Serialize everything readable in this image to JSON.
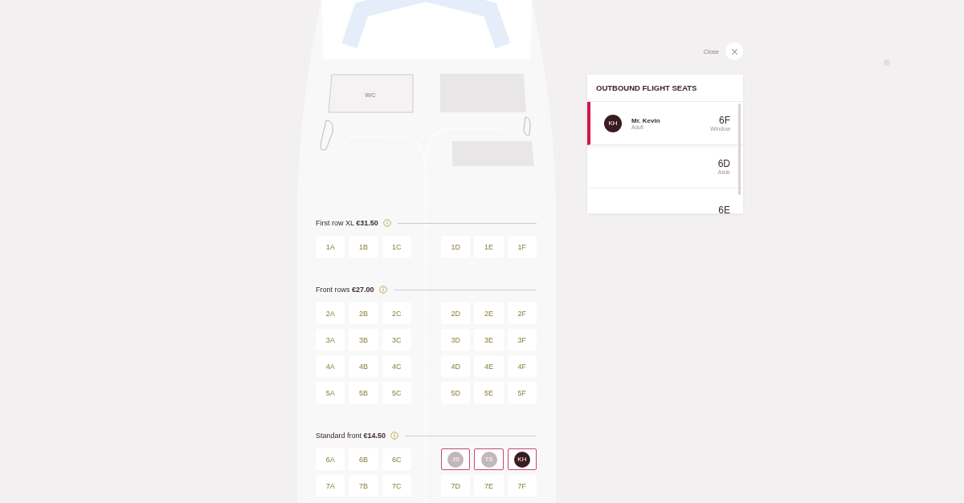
{
  "cabin": {
    "wc_label": "WC"
  },
  "sections": [
    {
      "label": "First row XL **€31.50**",
      "rows": [
        [
          {
            "kind": "free",
            "label": "1A"
          },
          {
            "kind": "free",
            "label": "1B"
          },
          {
            "kind": "free",
            "label": "1C"
          },
          {
            "kind": "free",
            "label": "1D"
          },
          {
            "kind": "free",
            "label": "1E"
          },
          {
            "kind": "free",
            "label": "1F"
          }
        ]
      ]
    },
    {
      "label": "Front rows **€27.00**",
      "rows": [
        [
          {
            "kind": "free",
            "label": "2A"
          },
          {
            "kind": "free",
            "label": "2B"
          },
          {
            "kind": "free",
            "label": "2C"
          },
          {
            "kind": "free",
            "label": "2D"
          },
          {
            "kind": "free",
            "label": "2E"
          },
          {
            "kind": "free",
            "label": "2F"
          }
        ],
        [
          {
            "kind": "free",
            "label": "3A"
          },
          {
            "kind": "free",
            "label": "3B"
          },
          {
            "kind": "free",
            "label": "3C"
          },
          {
            "kind": "free",
            "label": "3D"
          },
          {
            "kind": "free",
            "label": "3E"
          },
          {
            "kind": "free",
            "label": "3F"
          }
        ],
        [
          {
            "kind": "free",
            "label": "4A"
          },
          {
            "kind": "free",
            "label": "4B"
          },
          {
            "kind": "free",
            "label": "4C"
          },
          {
            "kind": "free",
            "label": "4D"
          },
          {
            "kind": "free",
            "label": "4E"
          },
          {
            "kind": "free",
            "label": "4F"
          }
        ],
        [
          {
            "kind": "free",
            "label": "5A"
          },
          {
            "kind": "free",
            "label": "5B"
          },
          {
            "kind": "free",
            "label": "5C"
          },
          {
            "kind": "free",
            "label": "5D"
          },
          {
            "kind": "free",
            "label": "5E"
          },
          {
            "kind": "free",
            "label": "5F"
          }
        ]
      ]
    },
    {
      "label": "Standard front **€14.50**",
      "rows": [
        [
          {
            "kind": "free",
            "label": "6A"
          },
          {
            "kind": "free",
            "label": "6B"
          },
          {
            "kind": "free",
            "label": "6C"
          },
          {
            "kind": "assigned",
            "initials": "JS",
            "selected": false
          },
          {
            "kind": "assigned",
            "initials": "TS",
            "selected": false
          },
          {
            "kind": "assigned",
            "initials": "KH",
            "selected": true
          }
        ],
        [
          {
            "kind": "free",
            "label": "7A"
          },
          {
            "kind": "free",
            "label": "7B"
          },
          {
            "kind": "free",
            "label": "7C"
          },
          {
            "kind": "free",
            "label": "7D"
          },
          {
            "kind": "free",
            "label": "7E"
          },
          {
            "kind": "free",
            "label": "7F"
          }
        ]
      ]
    }
  ],
  "close_label": "Close",
  "panel": {
    "title": "OUTBOUND FLIGHT SEATS",
    "passengers": [
      {
        "initials": "KH",
        "name": "Mr. Kevin",
        "type": "Adult",
        "seat": "6F",
        "position": "Window",
        "selected": true
      },
      {
        "seat": "6D",
        "position": "Aisle",
        "selected": false
      },
      {
        "seat": "6E",
        "selected": false
      }
    ]
  }
}
